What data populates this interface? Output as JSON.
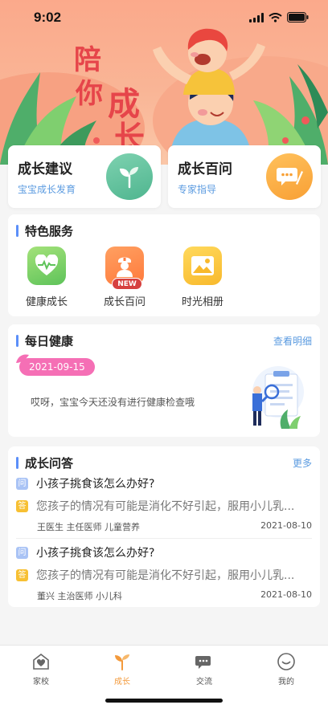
{
  "status_bar": {
    "time": "9:02"
  },
  "hero": {
    "title_chars": [
      "陪",
      "你",
      "成",
      "长"
    ]
  },
  "top_cards": [
    {
      "title": "成长建议",
      "subtitle": "宝宝成长发育",
      "icon": "sprout-icon"
    },
    {
      "title": "成长百问",
      "subtitle": "专家指导",
      "icon": "chat-pen-icon"
    }
  ],
  "features": {
    "title": "特色服务",
    "items": [
      {
        "label": "健康成长",
        "icon": "heart-pulse-icon"
      },
      {
        "label": "成长百问",
        "icon": "doctor-icon",
        "badge": "NEW"
      },
      {
        "label": "时光相册",
        "icon": "photo-icon"
      }
    ]
  },
  "daily_health": {
    "title": "每日健康",
    "more": "查看明细",
    "date": "2021-09-15",
    "message": "哎呀，宝宝今天还没有进行健康检查哦"
  },
  "qa": {
    "title": "成长问答",
    "more": "更多",
    "q_tag": "问",
    "a_tag": "答",
    "items": [
      {
        "question": "小孩子挑食该怎么办好?",
        "answer": "您孩子的情况有可能是消化不好引起，服用小儿乳...",
        "doctor": "王医生 主任医师 儿童营养",
        "date": "2021-08-10"
      },
      {
        "question": "小孩子挑食该怎么办好?",
        "answer": "您孩子的情况有可能是消化不好引起，服用小儿乳...",
        "doctor": "董兴 主治医师 小儿科",
        "date": "2021-08-10"
      }
    ]
  },
  "tabbar": {
    "items": [
      {
        "label": "家校",
        "icon": "school-icon",
        "active": false
      },
      {
        "label": "成长",
        "icon": "sprout-icon",
        "active": true
      },
      {
        "label": "交流",
        "icon": "chat-icon",
        "active": false
      },
      {
        "label": "我的",
        "icon": "profile-icon",
        "active": false
      }
    ]
  },
  "colors": {
    "accent_blue": "#5b8ff9",
    "accent_orange": "#f39a3c",
    "date_pill": "#f56fb5",
    "hero_bg": "#fba98b"
  }
}
